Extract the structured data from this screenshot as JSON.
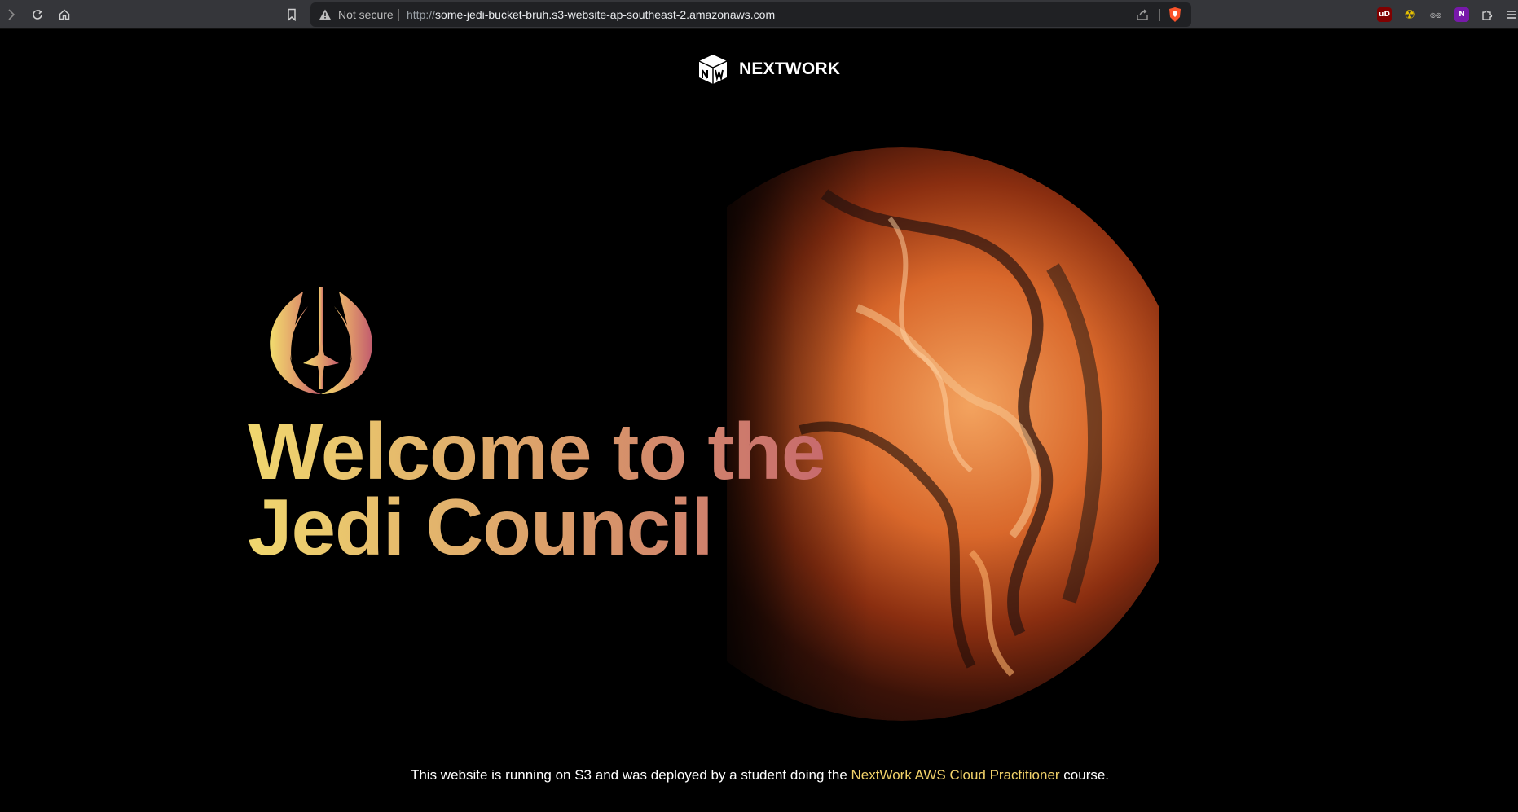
{
  "browser": {
    "not_secure_label": "Not secure",
    "url_protocol": "http://",
    "url_host": "some-jedi-bucket-bruh.s3-website-ap-southeast-2.amazonaws.com",
    "extensions": [
      {
        "name": "ublock-origin-icon",
        "label": "uD",
        "color": "#800000"
      },
      {
        "name": "radiation-icon",
        "label": "☢",
        "color": "#e8c200"
      },
      {
        "name": "spy-glasses-icon",
        "label": "◎◎",
        "color": "#dddddd"
      },
      {
        "name": "onenote-icon",
        "label": "N",
        "color": "#7719aa"
      },
      {
        "name": "extensions-puzzle-icon",
        "label": "✦",
        "color": "#dddddd"
      }
    ]
  },
  "page": {
    "brand_name": "NEXTWORK",
    "hero_line1": "Welcome to the",
    "hero_line2": "Jedi Council",
    "footer_prefix": "This website is running on S3 and was deployed by a student doing the ",
    "footer_link": "NextWork AWS Cloud Practitioner",
    "footer_suffix": " course."
  },
  "colors": {
    "gradient_start": "#f0d76e",
    "gradient_mid": "#d99a6a",
    "gradient_end": "#c25c6e",
    "link": "#f3d36a",
    "planet_orange": "#e07a3a"
  }
}
